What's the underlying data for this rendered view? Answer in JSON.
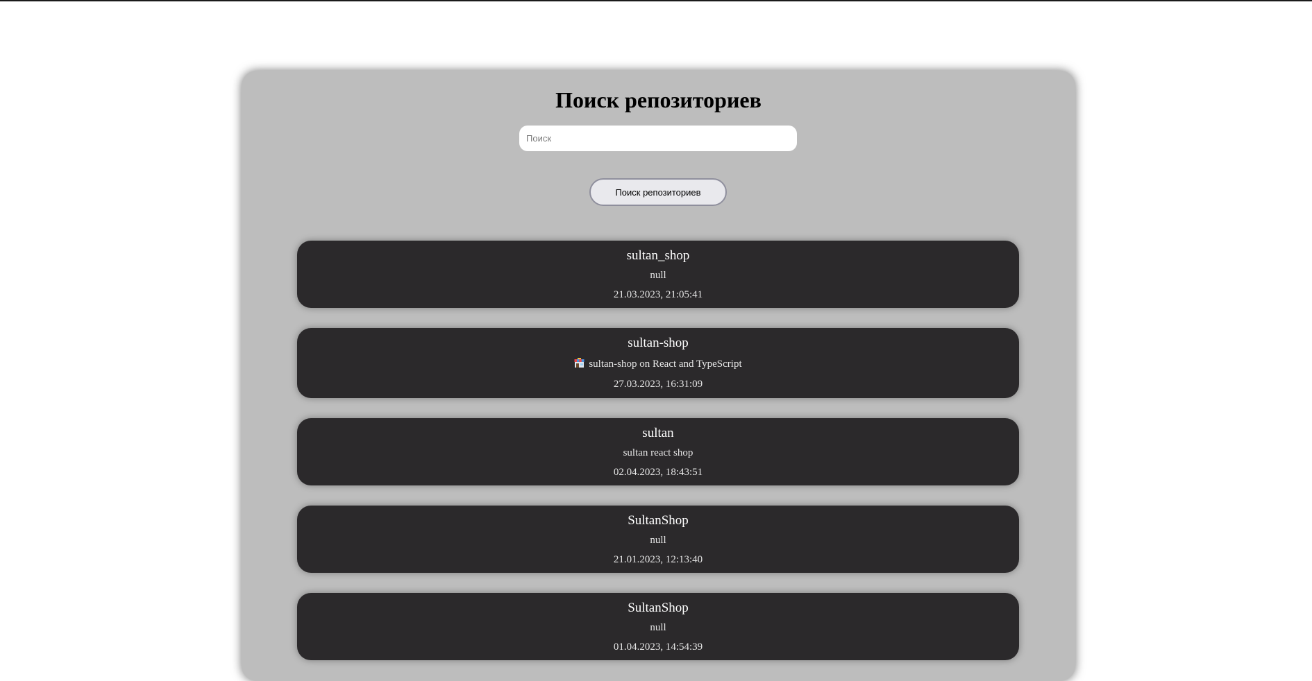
{
  "page": {
    "title": "Поиск репозиториев"
  },
  "search": {
    "placeholder": "Поиск",
    "value": "",
    "button_label": "Поиск репозиториев"
  },
  "repositories": [
    {
      "name": "sultan_shop",
      "description": "null",
      "updated": "21.03.2023, 21:05:41",
      "icon": ""
    },
    {
      "name": "sultan-shop",
      "description": "sultan-shop on React and TypeScript",
      "updated": "27.03.2023, 16:31:09",
      "icon": "shop-icon"
    },
    {
      "name": "sultan",
      "description": "sultan react shop",
      "updated": "02.04.2023, 18:43:51",
      "icon": ""
    },
    {
      "name": "SultanShop",
      "description": "null",
      "updated": "21.01.2023, 12:13:40",
      "icon": ""
    },
    {
      "name": "SultanShop",
      "description": "null",
      "updated": "01.04.2023, 14:54:39",
      "icon": ""
    }
  ],
  "colors": {
    "panel_background": "#bdbdbd",
    "card_background": "#2b292b",
    "card_text": "#ffffff",
    "button_background": "#e9e9ed"
  }
}
